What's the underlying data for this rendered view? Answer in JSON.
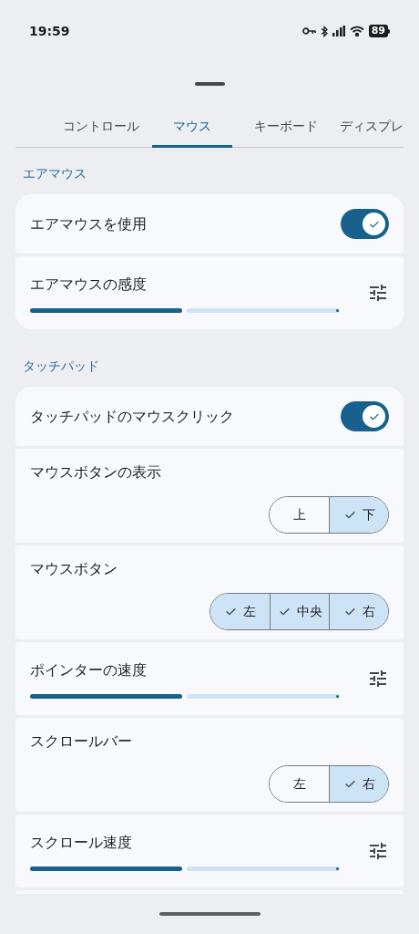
{
  "status_bar": {
    "time": "19:59",
    "battery": "89"
  },
  "tabs": [
    {
      "label": "コントロール",
      "selected": false
    },
    {
      "label": "マウス",
      "selected": true
    },
    {
      "label": "キーボード",
      "selected": false
    },
    {
      "label": "ディスプレ",
      "selected": false
    }
  ],
  "sections": [
    {
      "title": "エアマウス",
      "rows": [
        {
          "kind": "toggle",
          "label": "エアマウスを使用",
          "on": true
        },
        {
          "kind": "slider",
          "label": "エアマウスの感度",
          "level": 0.5
        }
      ]
    },
    {
      "title": "タッチパッド",
      "rows": [
        {
          "kind": "toggle",
          "label": "タッチパッドのマウスクリック",
          "on": true
        },
        {
          "kind": "segmented",
          "label": "マウスボタンの表示",
          "options": [
            {
              "label": "上",
              "selected": false
            },
            {
              "label": "下",
              "selected": true
            }
          ]
        },
        {
          "kind": "segmented",
          "label": "マウスボタン",
          "options": [
            {
              "label": "左",
              "selected": true
            },
            {
              "label": "中央",
              "selected": true
            },
            {
              "label": "右",
              "selected": true
            }
          ]
        },
        {
          "kind": "slider",
          "label": "ポインターの速度",
          "level": 0.5
        },
        {
          "kind": "segmented",
          "label": "スクロールバー",
          "options": [
            {
              "label": "左",
              "selected": false
            },
            {
              "label": "右",
              "selected": true
            }
          ]
        },
        {
          "kind": "slider",
          "label": "スクロール速度",
          "level": 0.5
        },
        {
          "kind": "blank"
        }
      ]
    }
  ]
}
